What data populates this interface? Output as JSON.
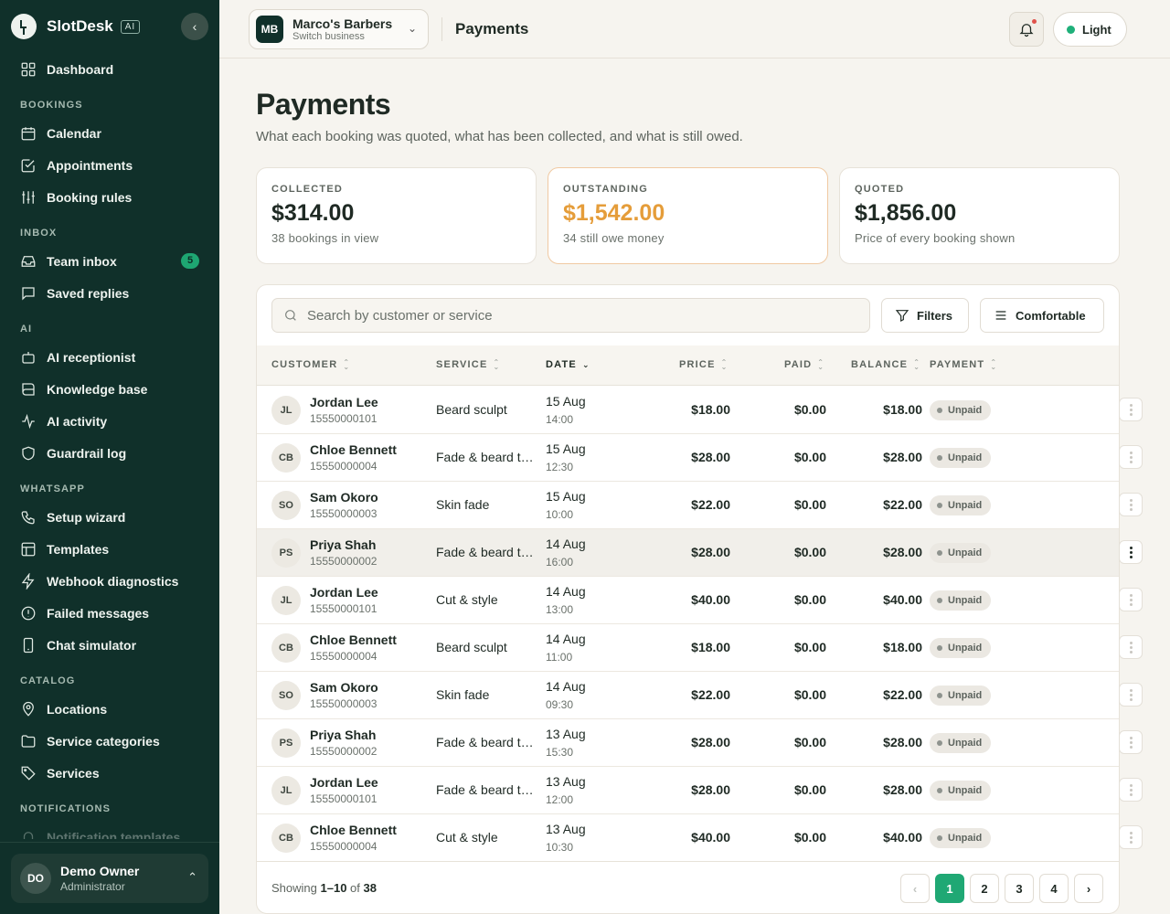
{
  "sidebar": {
    "brand": "SlotDesk",
    "brand_badge": "AI",
    "collapse_icon": "chevron-left-icon",
    "dashboard": "Dashboard",
    "sections": {
      "bookings": "BOOKINGS",
      "inbox": "INBOX",
      "ai": "AI",
      "whatsapp": "WHATSAPP",
      "catalog": "CATALOG",
      "notifications": "NOTIFICATIONS"
    },
    "items": {
      "calendar": "Calendar",
      "appointments": "Appointments",
      "booking_rules": "Booking rules",
      "team_inbox": "Team inbox",
      "team_inbox_count": "5",
      "saved_replies": "Saved replies",
      "ai_receptionist": "AI receptionist",
      "knowledge_base": "Knowledge base",
      "ai_activity": "AI activity",
      "guardrail_log": "Guardrail log",
      "setup_wizard": "Setup wizard",
      "templates": "Templates",
      "webhook_diagnostics": "Webhook diagnostics",
      "failed_messages": "Failed messages",
      "chat_simulator": "Chat simulator",
      "locations": "Locations",
      "service_categories": "Service categories",
      "services": "Services",
      "notification_templates": "Notification templates"
    },
    "owner": {
      "initials": "DO",
      "name": "Demo Owner",
      "role": "Administrator"
    }
  },
  "topbar": {
    "business_initials": "MB",
    "business_name": "Marco's Barbers",
    "business_sub": "Switch business",
    "title": "Payments",
    "theme_label": "Light",
    "colors": {
      "theme_dot": "#1fb07a",
      "notification_dot": "#e0524b"
    }
  },
  "page": {
    "title": "Payments",
    "subtitle": "What each booking was quoted, what has been collected, and what is still owed."
  },
  "stats": {
    "collected": {
      "label": "COLLECTED",
      "value": "$314.00",
      "sub": "38 bookings in view"
    },
    "outstanding": {
      "label": "OUTSTANDING",
      "value": "$1,542.00",
      "sub": "34 still owe money",
      "color": "#e59d3a"
    },
    "quoted": {
      "label": "QUOTED",
      "value": "$1,856.00",
      "sub": "Price of every booking shown"
    }
  },
  "toolbar": {
    "search_placeholder": "Search by customer or service",
    "filters_label": "Filters",
    "density_label": "Comfortable"
  },
  "table": {
    "headers": {
      "customer": "CUSTOMER",
      "service": "SERVICE",
      "date": "DATE",
      "price": "PRICE",
      "paid": "PAID",
      "balance": "BALANCE",
      "payment": "PAYMENT"
    },
    "rows": [
      {
        "initials": "JL",
        "name": "Jordan Lee",
        "phone": "15550000101",
        "service": "Beard sculpt",
        "date": "15 Aug",
        "time": "14:00",
        "price": "$18.00",
        "paid": "$0.00",
        "balance": "$18.00",
        "status": "Unpaid"
      },
      {
        "initials": "CB",
        "name": "Chloe Bennett",
        "phone": "15550000004",
        "service": "Fade & beard trim",
        "date": "15 Aug",
        "time": "12:30",
        "price": "$28.00",
        "paid": "$0.00",
        "balance": "$28.00",
        "status": "Unpaid"
      },
      {
        "initials": "SO",
        "name": "Sam Okoro",
        "phone": "15550000003",
        "service": "Skin fade",
        "date": "15 Aug",
        "time": "10:00",
        "price": "$22.00",
        "paid": "$0.00",
        "balance": "$22.00",
        "status": "Unpaid"
      },
      {
        "initials": "PS",
        "name": "Priya Shah",
        "phone": "15550000002",
        "service": "Fade & beard trim",
        "date": "14 Aug",
        "time": "16:00",
        "price": "$28.00",
        "paid": "$0.00",
        "balance": "$28.00",
        "status": "Unpaid"
      },
      {
        "initials": "JL",
        "name": "Jordan Lee",
        "phone": "15550000101",
        "service": "Cut & style",
        "date": "14 Aug",
        "time": "13:00",
        "price": "$40.00",
        "paid": "$0.00",
        "balance": "$40.00",
        "status": "Unpaid"
      },
      {
        "initials": "CB",
        "name": "Chloe Bennett",
        "phone": "15550000004",
        "service": "Beard sculpt",
        "date": "14 Aug",
        "time": "11:00",
        "price": "$18.00",
        "paid": "$0.00",
        "balance": "$18.00",
        "status": "Unpaid"
      },
      {
        "initials": "SO",
        "name": "Sam Okoro",
        "phone": "15550000003",
        "service": "Skin fade",
        "date": "14 Aug",
        "time": "09:30",
        "price": "$22.00",
        "paid": "$0.00",
        "balance": "$22.00",
        "status": "Unpaid"
      },
      {
        "initials": "PS",
        "name": "Priya Shah",
        "phone": "15550000002",
        "service": "Fade & beard trim",
        "date": "13 Aug",
        "time": "15:30",
        "price": "$28.00",
        "paid": "$0.00",
        "balance": "$28.00",
        "status": "Unpaid"
      },
      {
        "initials": "JL",
        "name": "Jordan Lee",
        "phone": "15550000101",
        "service": "Fade & beard trim",
        "date": "13 Aug",
        "time": "12:00",
        "price": "$28.00",
        "paid": "$0.00",
        "balance": "$28.00",
        "status": "Unpaid"
      },
      {
        "initials": "CB",
        "name": "Chloe Bennett",
        "phone": "15550000004",
        "service": "Cut & style",
        "date": "13 Aug",
        "time": "10:30",
        "price": "$40.00",
        "paid": "$0.00",
        "balance": "$40.00",
        "status": "Unpaid"
      }
    ]
  },
  "pagination": {
    "showing_prefix": "Showing",
    "range": "1–10",
    "of": "of",
    "total": "38",
    "pages": [
      "1",
      "2",
      "3",
      "4"
    ],
    "current": "1",
    "accent": "#1fa874"
  }
}
